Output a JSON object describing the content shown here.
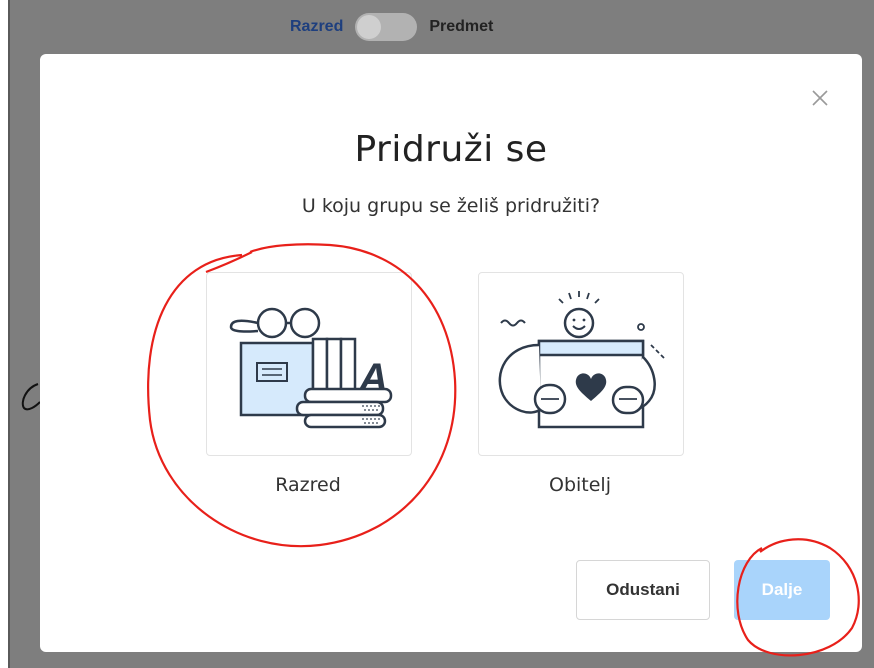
{
  "header": {
    "toggle_left_label": "Razred",
    "toggle_right_label": "Predmet"
  },
  "modal": {
    "title": "Pridruži se",
    "subtitle": "U koju grupu se želiš pridružiti?",
    "options": [
      {
        "label": "Razred",
        "icon": "classroom-books-icon"
      },
      {
        "label": "Obitelj",
        "icon": "family-heart-icon"
      }
    ],
    "cancel_label": "Odustani",
    "next_label": "Dalje"
  },
  "colors": {
    "overlay": "#7e7e7e",
    "toggle_active_text": "#1e3f7e",
    "next_button_disabled": "#a9d4fb",
    "illustration_blue": "#d6eafc",
    "illustration_dark": "#2e3a4a",
    "annotation_red": "#e8201a"
  }
}
